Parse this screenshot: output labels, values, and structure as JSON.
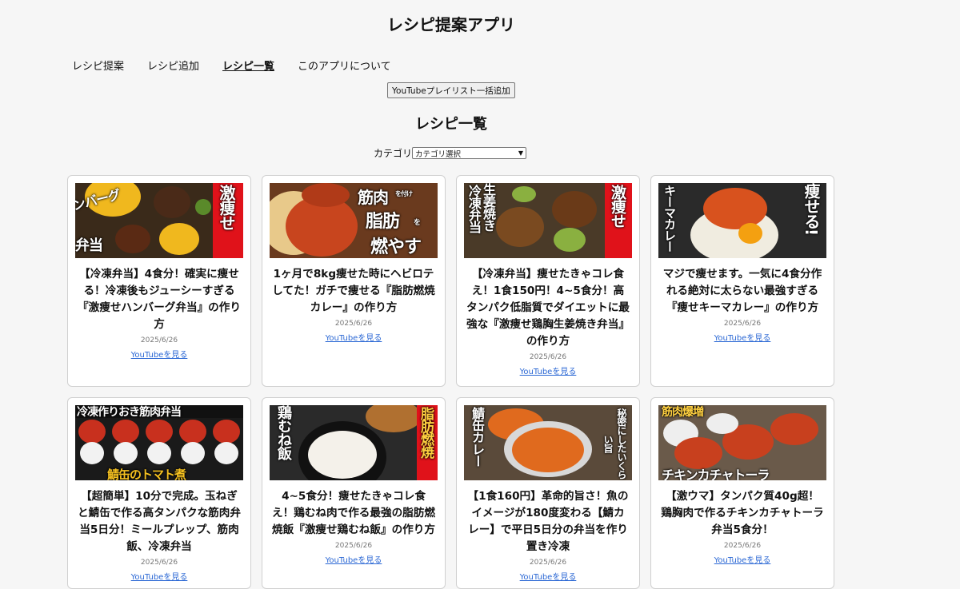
{
  "app": {
    "title": "レシピ提案アプリ"
  },
  "nav": [
    {
      "label": "レシピ提案",
      "active": false
    },
    {
      "label": "レシピ追加",
      "active": false
    },
    {
      "label": "レシピ一覧",
      "active": true
    },
    {
      "label": "このアプリについて",
      "active": false
    }
  ],
  "toolbar": {
    "import_label": "YouTubeプレイリスト一括追加"
  },
  "list": {
    "title": "レシピ一覧",
    "category_label": "カテゴリ",
    "category_selected": "カテゴリ選択"
  },
  "recipes": [
    {
      "title": "【冷凍弁当】4食分！確実に痩せる！冷凍後もジューシーすぎる『激痩せハンバーグ弁当』の作り方",
      "date": "2025/6/26",
      "link_label": "YouTubeを見る",
      "thumb_text": [
        "ンバーグ",
        "弁当",
        "激痩せ"
      ],
      "thumb_colors": {
        "bg": "#3a2a1a",
        "food": "#f0b81e",
        "accent": "#5a8a2a"
      }
    },
    {
      "title": "1ヶ月で8kg痩せた時にヘビロテしてた！ガチで痩せる『脂肪燃焼カレー』の作り方",
      "date": "2025/6/26",
      "link_label": "YouTubeを見る",
      "thumb_text": [
        "筋肉",
        "を付け",
        "脂肪",
        "を",
        "燃やす"
      ],
      "thumb_colors": {
        "bg": "#6a3a1e",
        "food": "#c8451e",
        "accent": "#e8c98a"
      }
    },
    {
      "title": "【冷凍弁当】痩せたきゃコレ食え！1食150円！4~5食分！高タンパク低脂質でダイエットに最強な『激痩せ鶏胸生姜焼き弁当』の作り方",
      "date": "2025/6/26",
      "link_label": "YouTubeを見る",
      "thumb_text": [
        "生姜焼き",
        "冷凍弁当",
        "激痩せ"
      ],
      "thumb_colors": {
        "bg": "#4a3a28",
        "food": "#7a4a20",
        "accent": "#8ab040"
      }
    },
    {
      "title": "マジで痩せます。一気に4食分作れる絶対に太らない最強すぎる『痩せキーマカレー』の作り方",
      "date": "2025/6/26",
      "link_label": "YouTubeを見る",
      "thumb_text": [
        "キーマカレー",
        "痩せる!"
      ],
      "thumb_colors": {
        "bg": "#2a2a2a",
        "food": "#d8521e",
        "accent": "#f0ece0"
      }
    },
    {
      "title": "【超簡単】10分で完成。玉ねぎと鯖缶で作る高タンパクな筋肉弁当5日分！ミールプレップ、筋肉飯、冷凍弁当",
      "date": "2025/6/26",
      "link_label": "YouTubeを見る",
      "thumb_text": [
        "冷凍作りおき筋肉弁当",
        "鯖缶のトマト煮"
      ],
      "thumb_colors": {
        "bg": "#1a1a1a",
        "food": "#c8301e",
        "accent": "#f2f2f2"
      }
    },
    {
      "title": "4~5食分！痩せたきゃコレ食え！鶏むね肉で作る最強の脂肪燃焼飯『激痩せ鶏むね飯』の作り方",
      "date": "2025/6/26",
      "link_label": "YouTubeを見る",
      "thumb_text": [
        "鶏むね飯",
        "脂肪燃焼"
      ],
      "thumb_colors": {
        "bg": "#2a2a2a",
        "food": "#f4f1ea",
        "accent": "#b07030"
      }
    },
    {
      "title": "【1食160円】革命的旨さ！魚のイメージが180度変わる【鯖カレー】で平日5日分の弁当を作り置き冷凍",
      "date": "2025/6/26",
      "link_label": "YouTubeを見る",
      "thumb_text": [
        "鯖缶カレー",
        "秘密にしたいくらい旨"
      ],
      "thumb_colors": {
        "bg": "#5a4a3a",
        "food": "#e06a1e",
        "accent": "#d8d8d8"
      }
    },
    {
      "title": "【激ウマ】タンパク質40g超！鶏胸肉で作るチキンカチャトーラ弁当5食分！",
      "date": "2025/6/26",
      "link_label": "YouTubeを見る",
      "thumb_text": [
        "筋肉爆増",
        "チキンカチャトーラ"
      ],
      "thumb_colors": {
        "bg": "#6a5a4a",
        "food": "#c8401e",
        "accent": "#eeeeee"
      }
    }
  ]
}
